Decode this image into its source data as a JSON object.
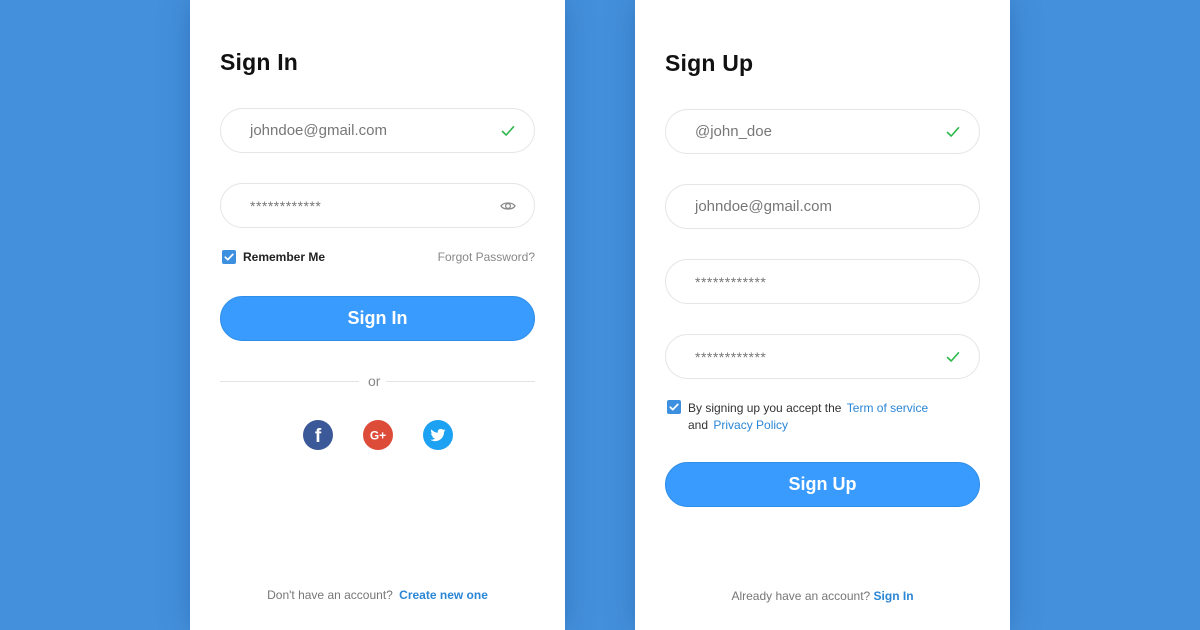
{
  "colors": {
    "background": "#4490dc",
    "accent": "#3a9bff",
    "link": "#2a86d6",
    "check": "#2db84a",
    "facebook": "#3b5998",
    "google": "#dd4b39",
    "twitter": "#1da1f2"
  },
  "signin": {
    "title": "Sign In",
    "email_value": "johndoe@gmail.com",
    "password_value": "************",
    "remember_label": "Remember Me",
    "forgot_label": "Forgot Password?",
    "submit_label": "Sign In",
    "divider_text": "or",
    "social": [
      {
        "name": "facebook",
        "icon": "facebook-icon",
        "glyph": "f"
      },
      {
        "name": "google-plus",
        "icon": "google-plus-icon",
        "glyph": "G+"
      },
      {
        "name": "twitter",
        "icon": "twitter-icon"
      }
    ],
    "footer_text": "Don't have an account?",
    "footer_link": "Create new one",
    "icons": {
      "email_valid": "check-icon",
      "password_toggle": "eye-icon"
    }
  },
  "signup": {
    "title": "Sign Up",
    "username_value": "@john_doe",
    "email_value": "johndoe@gmail.com",
    "password_value": "************",
    "confirm_value": "************",
    "terms_text_1": "By signing up you accept the",
    "terms_link_1": "Term of service",
    "terms_text_2": "and",
    "terms_link_2": "Privacy Policy",
    "submit_label": "Sign Up",
    "footer_text": "Already have an account?",
    "footer_link": "Sign In",
    "icons": {
      "username_valid": "check-icon",
      "confirm_valid": "check-icon"
    }
  }
}
